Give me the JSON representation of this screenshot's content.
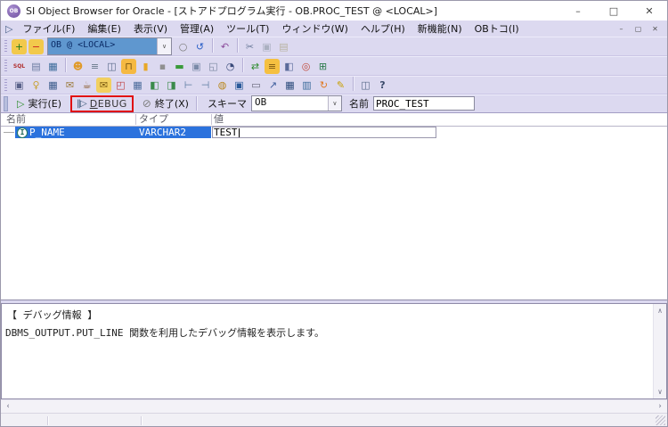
{
  "colors": {
    "accent": "#dcd9f0",
    "selection": "#2b72dd",
    "highlight-red": "#e01010",
    "combo-selection": "#5f97cf",
    "status-bg": "#f1f0f5"
  },
  "window": {
    "title": "SI Object Browser for Oracle - [ストアドプログラム実行 - OB.PROC_TEST @ <LOCAL>]",
    "app_badge": "OB",
    "controls": [
      {
        "name": "minimize-button",
        "glyph": "–",
        "fg": "#444"
      },
      {
        "name": "maximize-button",
        "glyph": "□",
        "fg": "#444"
      },
      {
        "name": "close-button",
        "glyph": "✕",
        "fg": "#444"
      }
    ]
  },
  "menu": {
    "window_icon": "▷",
    "items": [
      {
        "name": "menu-file",
        "label": "ファイル(F)"
      },
      {
        "name": "menu-edit",
        "label": "編集(E)"
      },
      {
        "name": "menu-view",
        "label": "表示(V)"
      },
      {
        "name": "menu-manage",
        "label": "管理(A)"
      },
      {
        "name": "menu-tools",
        "label": "ツール(T)"
      },
      {
        "name": "menu-window",
        "label": "ウィンドウ(W)"
      },
      {
        "name": "menu-help",
        "label": "ヘルプ(H)"
      },
      {
        "name": "menu-new-features",
        "label": "新機能(N)"
      },
      {
        "name": "menu-obtoko",
        "label": "OBトコ(I)"
      }
    ],
    "mdi_controls": [
      {
        "name": "mdi-minimize-button",
        "glyph": "–",
        "fg": "#555"
      },
      {
        "name": "mdi-restore-button",
        "glyph": "▢",
        "fg": "#555"
      },
      {
        "name": "mdi-close-button",
        "glyph": "✕",
        "fg": "#555"
      }
    ]
  },
  "connection": {
    "value": "OB @ <LOCAL>"
  },
  "toolbars": {
    "row1a": [
      {
        "name": "connect-database-icon",
        "glyph": "+",
        "fg": "#1f7a1f",
        "bg": "#f2c94c"
      },
      {
        "name": "disconnect-database-icon",
        "glyph": "−",
        "fg": "#cc2222",
        "bg": "#f2c94c"
      }
    ],
    "row1b": [
      {
        "name": "commit-icon",
        "glyph": "○",
        "fg": "#7a7a7a"
      },
      {
        "name": "rollback-icon",
        "glyph": "↺",
        "fg": "#2b5fc7"
      },
      {
        "sep": true
      },
      {
        "name": "undo-icon",
        "glyph": "↶",
        "fg": "#8a4a9a"
      },
      {
        "sep": true
      },
      {
        "name": "cut-icon",
        "glyph": "✂",
        "fg": "#6a7a9a"
      },
      {
        "name": "copy-icon",
        "glyph": "▣",
        "fg": "#aab0c0"
      },
      {
        "name": "paste-icon",
        "glyph": "▤",
        "fg": "#b8b2a0"
      }
    ],
    "row2": [
      {
        "name": "sql-editor-icon",
        "glyph": "SQL",
        "fg": "#b03030",
        "cls": "txt"
      },
      {
        "name": "script-editor-icon",
        "glyph": "▤",
        "fg": "#6a7aa0"
      },
      {
        "name": "result-set-icon",
        "glyph": "▦",
        "fg": "#3a6a9a"
      },
      {
        "sep": true
      },
      {
        "name": "user-icon",
        "glyph": "☻",
        "fg": "#e09a28"
      },
      {
        "name": "session-icon",
        "glyph": "≡",
        "fg": "#667788"
      },
      {
        "name": "database-server-icon",
        "glyph": "◫",
        "fg": "#5a6a8a"
      },
      {
        "name": "lock-icon",
        "glyph": "⊓",
        "fg": "#7a5510",
        "bg": "#f5b942"
      },
      {
        "name": "tablespace-icon",
        "glyph": "▮",
        "fg": "#e8a828"
      },
      {
        "name": "role-icon",
        "glyph": "▪",
        "fg": "#909090"
      },
      {
        "name": "memory-icon",
        "glyph": "▬",
        "fg": "#3a9a3a"
      },
      {
        "name": "object-copy-icon",
        "glyph": "▣",
        "fg": "#7a8aa8"
      },
      {
        "name": "recycle-bin-icon",
        "glyph": "◱",
        "fg": "#7a86a0"
      },
      {
        "name": "session-monitor-icon",
        "glyph": "◔",
        "fg": "#3a4a7a"
      },
      {
        "sep": true
      },
      {
        "name": "import-export-icon",
        "glyph": "⇄",
        "fg": "#2a8a2a"
      },
      {
        "name": "report-icon",
        "glyph": "≡",
        "fg": "#7a5510",
        "bg": "#f5c040"
      },
      {
        "name": "source-compare-icon",
        "glyph": "◧",
        "fg": "#5a6a9a"
      },
      {
        "name": "object-search-icon",
        "glyph": "◎",
        "fg": "#c04838"
      },
      {
        "name": "data-transfer-icon",
        "glyph": "⊞",
        "fg": "#2a7a4a"
      }
    ],
    "row3": [
      {
        "name": "table-window-icon",
        "glyph": "▣",
        "fg": "#5a628a"
      },
      {
        "name": "key-icon",
        "glyph": "♀",
        "fg": "#c8a232"
      },
      {
        "name": "table-list-icon",
        "glyph": "▦",
        "fg": "#3a5a8a"
      },
      {
        "name": "mail-send-icon",
        "glyph": "✉",
        "fg": "#9a7a3a"
      },
      {
        "name": "coffee-break-icon",
        "glyph": "☕",
        "fg": "#8a5a2a"
      },
      {
        "name": "mail-folder-icon",
        "glyph": "✉",
        "fg": "#7a5a10",
        "bg": "#f2d060"
      },
      {
        "name": "procedure-window-icon",
        "glyph": "◰",
        "fg": "#c04040"
      },
      {
        "name": "data-grid-icon",
        "glyph": "▦",
        "fg": "#4a6a9a"
      },
      {
        "name": "definition-window-icon",
        "glyph": "◧",
        "fg": "#3a8a4a"
      },
      {
        "name": "source-window-icon",
        "glyph": "◨",
        "fg": "#3a8a4a"
      },
      {
        "name": "tree-collapse-icon",
        "glyph": "⊢",
        "fg": "#5a7aa0"
      },
      {
        "name": "tree-expand-icon",
        "glyph": "⊣",
        "fg": "#5a7aa0"
      },
      {
        "name": "option-window-icon",
        "glyph": "◍",
        "fg": "#b8861b"
      },
      {
        "name": "window-copy-icon",
        "glyph": "▣",
        "fg": "#2a5a9a"
      },
      {
        "name": "blank-window-icon",
        "glyph": "▭",
        "fg": "#666677"
      },
      {
        "name": "shortcut-icon",
        "glyph": "↗",
        "fg": "#3a5a9a"
      },
      {
        "name": "grid-window-icon",
        "glyph": "▦",
        "fg": "#2a4a7a"
      },
      {
        "name": "er-diagram-icon",
        "glyph": "▥",
        "fg": "#3a6a9a"
      },
      {
        "name": "refresh-icon",
        "glyph": "↻",
        "fg": "#e07820"
      },
      {
        "name": "edit-memo-icon",
        "glyph": "✎",
        "fg": "#c8a000"
      },
      {
        "sep": true
      },
      {
        "name": "split-window-icon",
        "glyph": "◫",
        "fg": "#5a6a8a"
      },
      {
        "name": "help-icon",
        "glyph": "?",
        "fg": "#3a4a6a",
        "cls": "txtb"
      }
    ]
  },
  "action_bar": {
    "run_label": "実行(E)",
    "debug_label_d": "D",
    "debug_label_rest": "EBUG",
    "stop_label": "終了(X)",
    "schema_label": "スキーマ",
    "schema_value": "OB",
    "name_label": "名前",
    "name_value": "PROC_TEST"
  },
  "param_grid": {
    "columns": [
      "名前",
      "タイプ",
      "値"
    ],
    "rows": [
      {
        "name": "P_NAME",
        "type": "VARCHAR2",
        "value": "TEST",
        "icon": "in-parameter",
        "icon_letter": "I"
      }
    ]
  },
  "debug_panel": {
    "title": "【 デバッグ情報 】",
    "message": "DBMS_OUTPUT.PUT_LINE 関数を利用したデバッグ情報を表示します。"
  }
}
